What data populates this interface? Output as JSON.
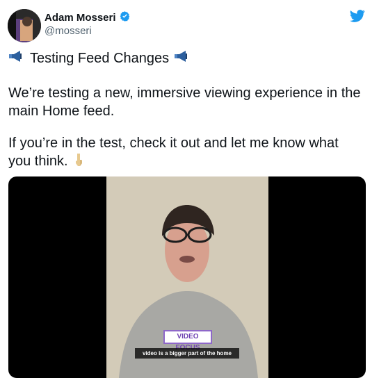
{
  "tweet": {
    "author": {
      "name": "Adam Mosseri",
      "handle": "@mosseri",
      "verified": true
    },
    "lines": [
      "Testing Feed Changes",
      "We’re testing a new, immersive viewing experience in the",
      "main Home feed.",
      "If you’re in the test, check it out and let me know what",
      "you think."
    ],
    "emoji": {
      "megaphone": "megaphone-icon",
      "pointing_down": "pointing-down-icon"
    }
  },
  "video": {
    "badge": "VIDEO FOCUS",
    "caption": "video is a bigger part of the home"
  },
  "colors": {
    "twitter_blue": "#1d9bf0",
    "badge_purple": "#8e67c9"
  }
}
